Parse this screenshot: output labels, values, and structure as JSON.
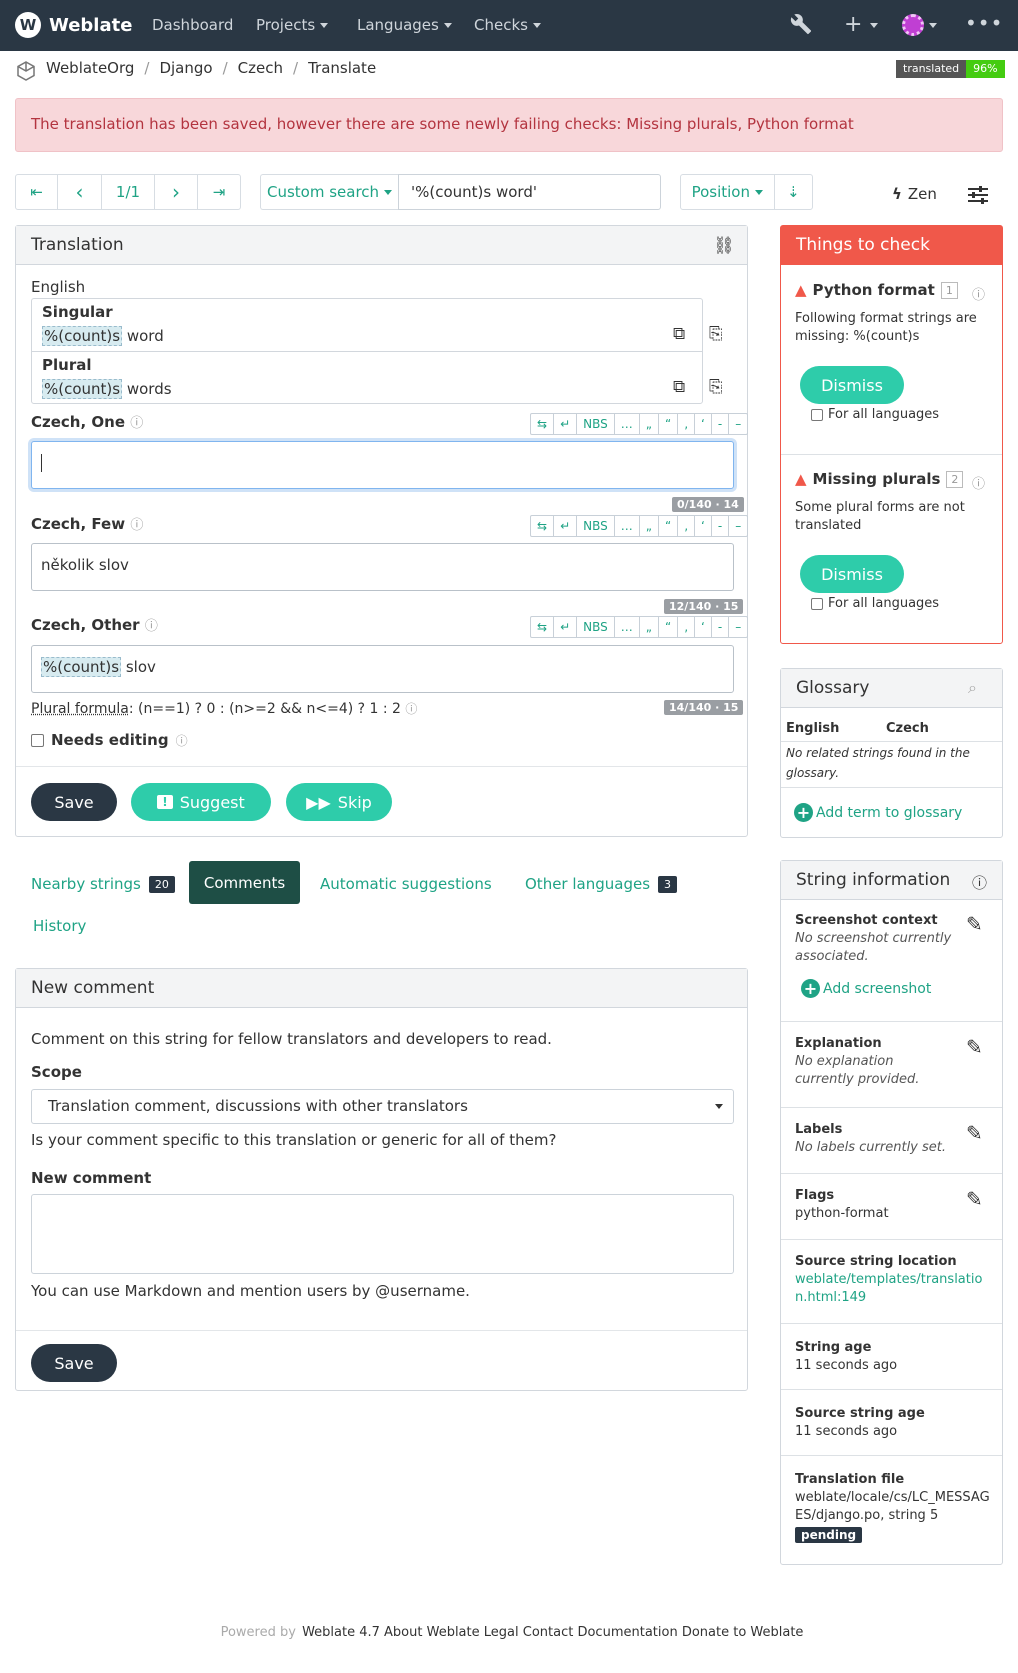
{
  "nav": {
    "brand": "Weblate",
    "logo_glyph": "W",
    "items": [
      "Dashboard",
      "Projects",
      "Languages",
      "Checks"
    ]
  },
  "breadcrumb": [
    "WeblateOrg",
    "Django",
    "Czech",
    "Translate"
  ],
  "status_badge": {
    "label": "translated",
    "value": "96%"
  },
  "alert": "The translation has been saved, however there are some newly failing checks: Missing plurals, Python format",
  "pager": {
    "position": "1/1"
  },
  "search": {
    "button": "Custom search",
    "query": "'%(count)s word'"
  },
  "sort": {
    "button": "Position"
  },
  "zen_label": "Zen",
  "translation_panel": {
    "title": "Translation",
    "source_language": "English",
    "source": [
      {
        "form": "Singular",
        "placeable": "%(count)s",
        "text": " word"
      },
      {
        "form": "Plural",
        "placeable": "%(count)s",
        "text": " words"
      }
    ],
    "editor_buttons": [
      "NBS",
      "…",
      "„",
      "“",
      "‚",
      "‘",
      "-",
      "–"
    ],
    "targets": [
      {
        "label": "Czech, One",
        "value": "",
        "counter": "0/140 · 14"
      },
      {
        "label": "Czech, Few",
        "value": "několik slov",
        "counter": "12/140 · 15"
      },
      {
        "label": "Czech, Other",
        "placeable": "%(count)s",
        "value": " slov",
        "counter": "14/140 · 15"
      }
    ],
    "plural_formula_label": "Plural formula",
    "plural_formula": ": (n==1) ? 0 : (n>=2 && n<=4) ? 1 : 2",
    "needs_editing": "Needs editing",
    "save": "Save",
    "suggest": "Suggest",
    "skip": "Skip"
  },
  "tabs": [
    {
      "label": "Nearby strings",
      "count": "20"
    },
    {
      "label": "Comments",
      "count": ""
    },
    {
      "label": "Automatic suggestions",
      "count": ""
    },
    {
      "label": "Other languages",
      "count": "3"
    },
    {
      "label": "History",
      "count": ""
    }
  ],
  "comment_panel": {
    "title": "New comment",
    "intro": "Comment on this string for fellow translators and developers to read.",
    "scope_label": "Scope",
    "scope_value": "Translation comment, discussions with other translators",
    "scope_help": "Is your comment specific to this translation or generic for all of them?",
    "comment_label": "New comment",
    "comment_help": "You can use Markdown and mention users by @username.",
    "save": "Save"
  },
  "checks": {
    "title": "Things to check",
    "items": [
      {
        "name": "Python format",
        "count": "1",
        "desc": "Following format strings are missing: %(count)s",
        "dismiss": "Dismiss",
        "all_langs": "For all languages"
      },
      {
        "name": "Missing plurals",
        "count": "2",
        "desc": "Some plural forms are not translated",
        "dismiss": "Dismiss",
        "all_langs": "For all languages"
      }
    ]
  },
  "glossary": {
    "title": "Glossary",
    "col_source": "English",
    "col_target": "Czech",
    "empty": "No related strings found in the glossary.",
    "add": "Add term to glossary"
  },
  "string_info": {
    "title": "String information",
    "screenshot_label": "Screenshot context",
    "screenshot_value": "No screenshot currently associated.",
    "add_screenshot": "Add screenshot",
    "explanation_label": "Explanation",
    "explanation_value": "No explanation currently provided.",
    "labels_label": "Labels",
    "labels_value": "No labels currently set.",
    "flags_label": "Flags",
    "flags_value": "python-format",
    "location_label": "Source string location",
    "location_value": "weblate/templates/translation.html:149",
    "age_label": "String age",
    "age_value": "11 seconds ago",
    "source_age_label": "Source string age",
    "source_age_value": "11 seconds ago",
    "file_label": "Translation file",
    "file_value": "weblate/locale/cs/LC_MESSAGES/django.po, string 5",
    "pending": "pending"
  },
  "footer": {
    "powered_prefix": "Powered by",
    "powered": "Weblate 4.7",
    "links": [
      "About Weblate",
      "Legal",
      "Contact",
      "Documentation",
      "Donate to Weblate"
    ]
  },
  "colors": {
    "accent": "#1fa385",
    "nav": "#2a3744",
    "danger": "#f0584a"
  }
}
